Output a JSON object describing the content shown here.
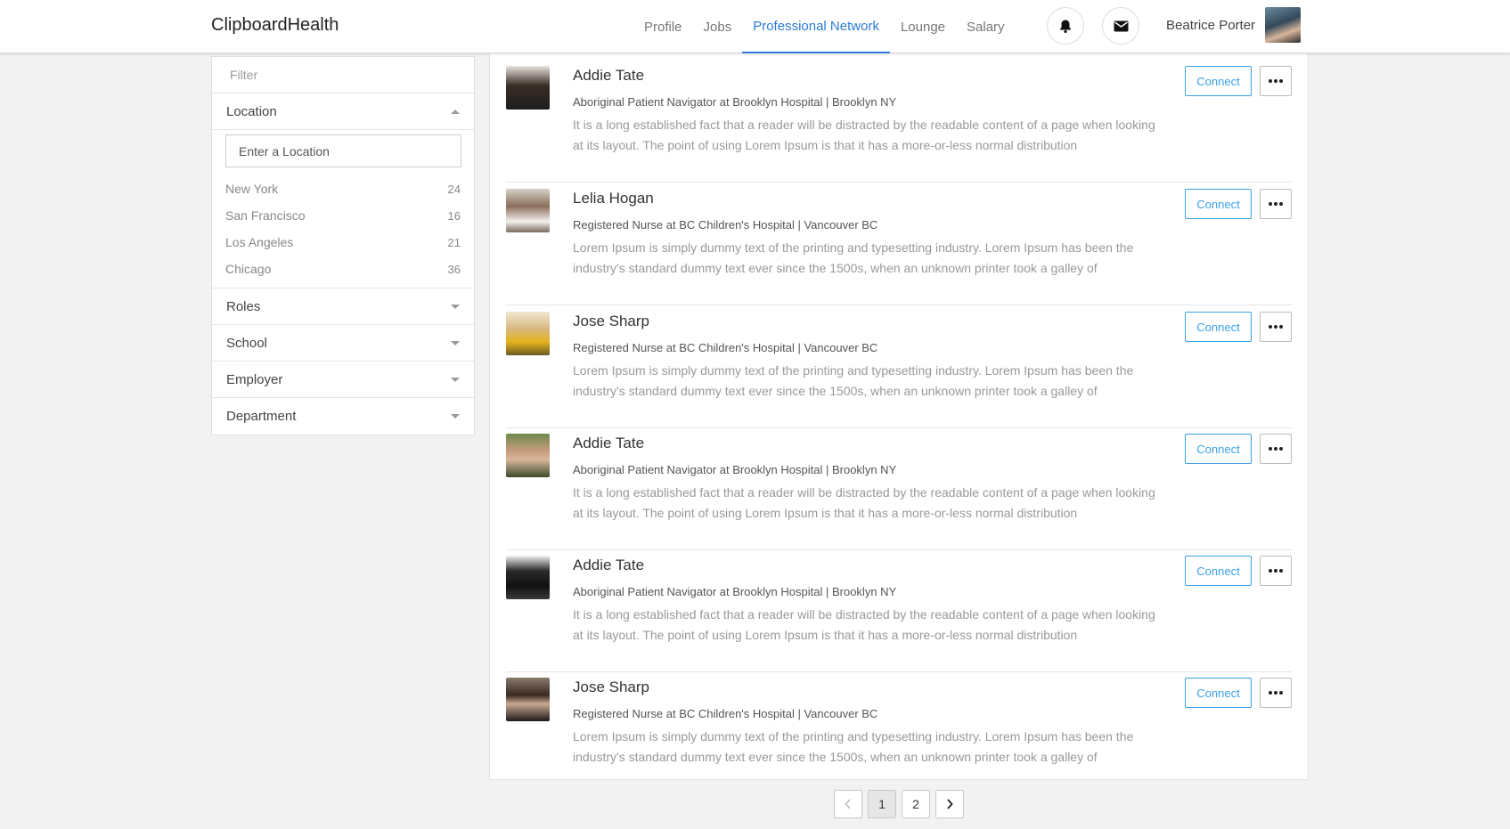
{
  "brand": "ClipboardHealth",
  "nav": [
    {
      "label": "Profile"
    },
    {
      "label": "Jobs"
    },
    {
      "label": "Professional Network",
      "active": true
    },
    {
      "label": "Lounge"
    },
    {
      "label": "Salary"
    }
  ],
  "header": {
    "user_name": "Beatrice Porter",
    "icons": [
      "bell-icon",
      "mail-icon"
    ]
  },
  "sidebar": {
    "filter_placeholder": "Filter",
    "location": {
      "label": "Location",
      "input_placeholder": "Enter a Location",
      "items": [
        {
          "name": "New York",
          "count": "24"
        },
        {
          "name": "San Francisco",
          "count": "16"
        },
        {
          "name": "Los Angeles",
          "count": "21"
        },
        {
          "name": "Chicago",
          "count": "36"
        }
      ]
    },
    "sections": [
      "Roles",
      "School",
      "Employer",
      "Department"
    ]
  },
  "people": [
    {
      "name": "Addie Tate",
      "role": "Aboriginal Patient Navigator at Brooklyn Hospital | Brooklyn NY",
      "text": "It is a long established fact that a reader will be distracted by the readable content of a page when looking at its layout. The point of using Lorem Ipsum is that it has a more-or-less normal distribution",
      "connect": "Connect"
    },
    {
      "name": "Lelia Hogan",
      "role": "Registered Nurse at BC Children's Hospital | Vancouver BC",
      "text": "Lorem Ipsum is simply dummy text of the printing and typesetting industry. Lorem Ipsum has been the industry's standard dummy text ever since the 1500s, when an unknown printer took a galley of",
      "connect": "Connect"
    },
    {
      "name": "Jose Sharp",
      "role": "Registered Nurse at BC Children's Hospital | Vancouver BC",
      "text": "Lorem Ipsum is simply dummy text of the printing and typesetting industry. Lorem Ipsum has been the industry's standard dummy text ever since the 1500s, when an unknown printer took a galley of",
      "connect": "Connect"
    },
    {
      "name": "Addie Tate",
      "role": "Aboriginal Patient Navigator at Brooklyn Hospital | Brooklyn NY",
      "text": "It is a long established fact that a reader will be distracted by the readable content of a page when looking at its layout. The point of using Lorem Ipsum is that it has a more-or-less normal distribution",
      "connect": "Connect"
    },
    {
      "name": "Addie Tate",
      "role": "Aboriginal Patient Navigator at Brooklyn Hospital | Brooklyn NY",
      "text": "It is a long established fact that a reader will be distracted by the readable content of a page when looking at its layout. The point of using Lorem Ipsum is that it has a more-or-less normal distribution",
      "connect": "Connect"
    },
    {
      "name": "Jose Sharp",
      "role": "Registered Nurse at BC Children's Hospital | Vancouver BC",
      "text": "Lorem Ipsum is simply dummy text of the printing and typesetting industry. Lorem Ipsum has been the industry's standard dummy text ever since the 1500s, when an unknown printer took a galley of",
      "connect": "Connect"
    }
  ],
  "pagination": {
    "pages": [
      "1",
      "2"
    ],
    "current": "1"
  },
  "colors": {
    "accent": "#2b7bd6",
    "connect": "#3aa0e8"
  }
}
